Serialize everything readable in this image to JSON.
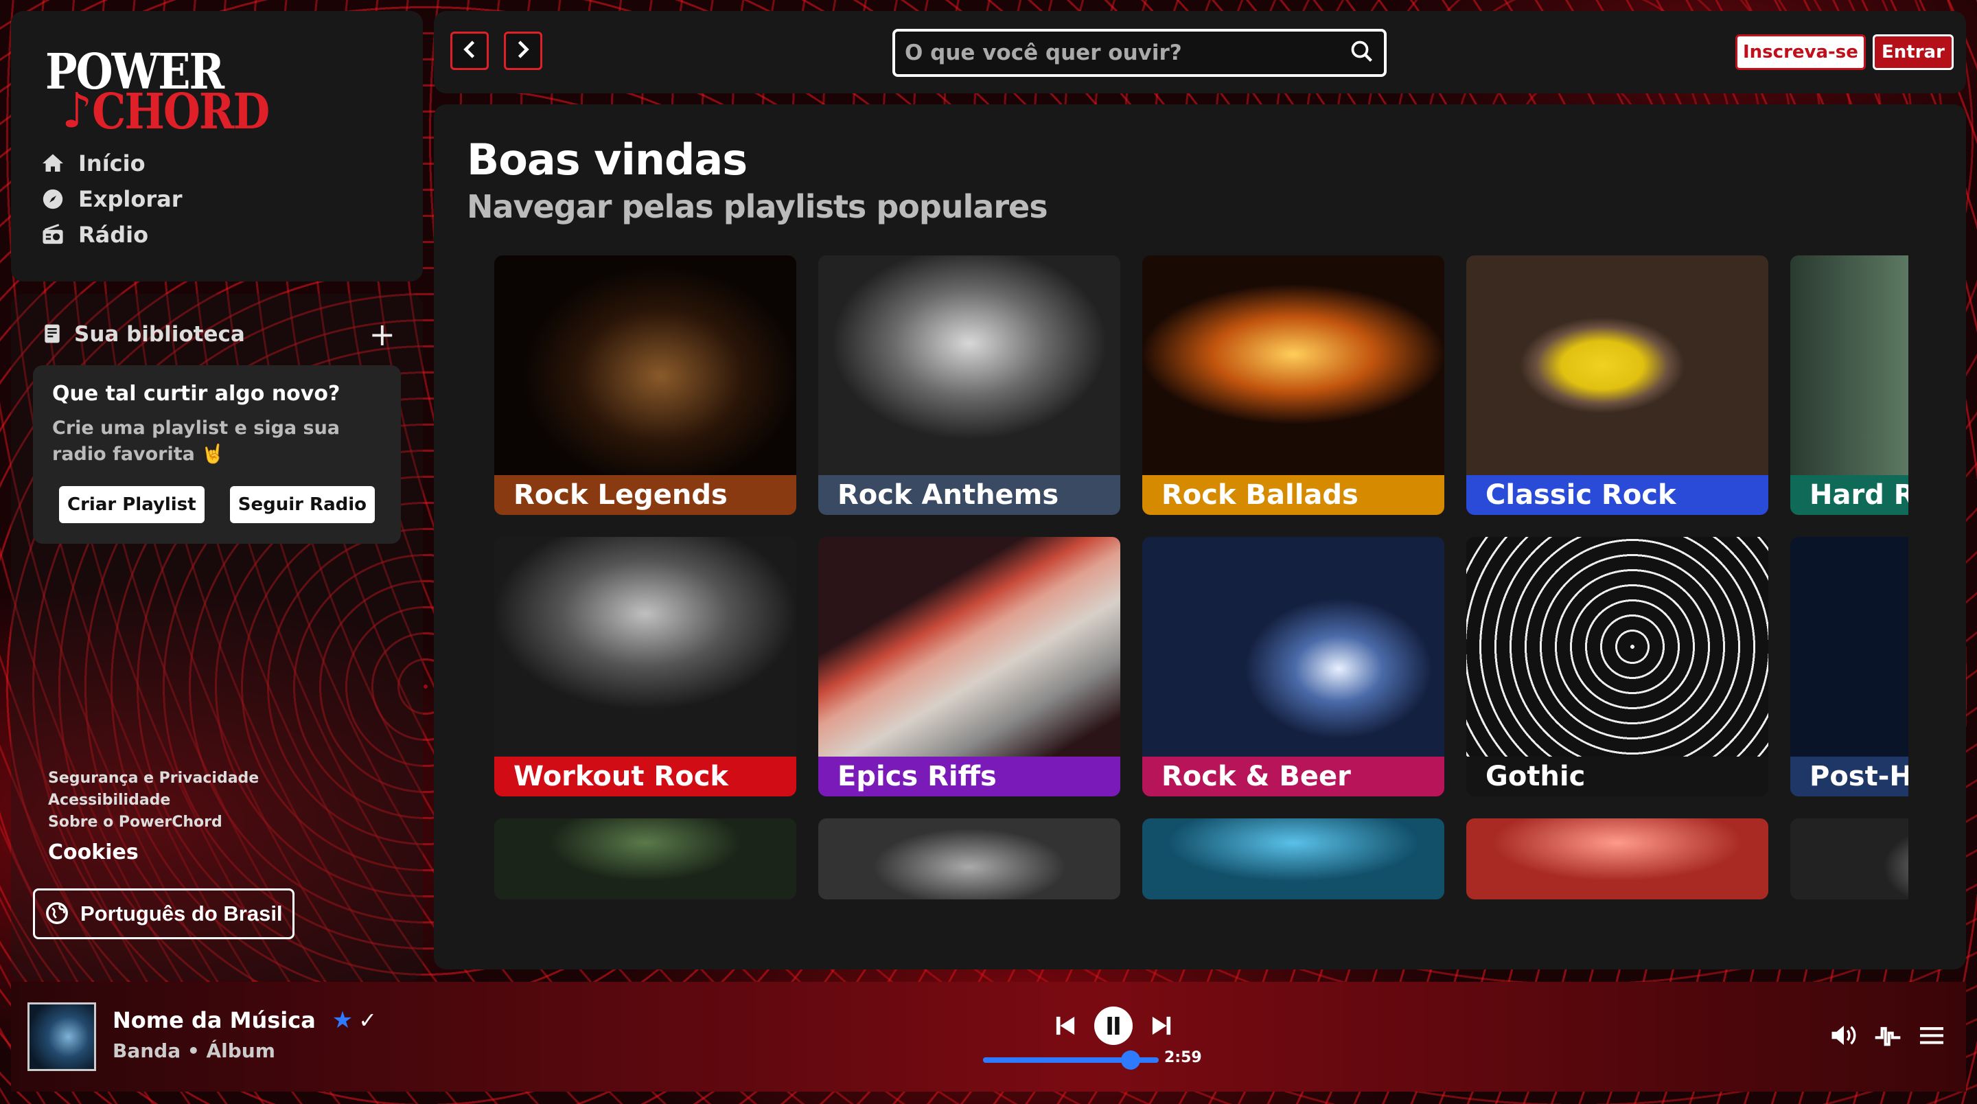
{
  "app": {
    "logo_line1": "POWER",
    "logo_line2": "CHORD"
  },
  "nav": {
    "items": [
      {
        "label": "Início",
        "icon": "home-icon"
      },
      {
        "label": "Explorar",
        "icon": "compass-icon"
      },
      {
        "label": "Rádio",
        "icon": "radio-icon"
      }
    ]
  },
  "library": {
    "title": "Sua biblioteca",
    "add_icon": "plus-icon",
    "promo": {
      "heading": "Que tal curtir algo novo?",
      "text": "Crie uma playlist e siga sua radio favorita 🤘",
      "create_button": "Criar Playlist",
      "follow_button": "Seguir Radio"
    },
    "footer_links": [
      "Segurança e Privacidade",
      "Acessibilidade",
      "Sobre o PowerChord"
    ],
    "cookies": "Cookies",
    "language_button": "Português do Brasil"
  },
  "topbar": {
    "search_placeholder": "O que você quer ouvir?",
    "signup_button": "Inscreva-se",
    "login_button": "Entrar"
  },
  "main": {
    "title": "Boas vindas",
    "subtitle": "Navegar pelas playlists populares",
    "playlists": [
      {
        "label": "Rock Legends",
        "color": "#8a3a10"
      },
      {
        "label": "Rock Anthems",
        "color": "#3a4a62"
      },
      {
        "label": "Rock Ballads",
        "color": "#d68a00"
      },
      {
        "label": "Classic Rock",
        "color": "#2a4ad8"
      },
      {
        "label": "Hard Rock",
        "color": "#0f6b58"
      },
      {
        "label": "Workout Rock",
        "color": "#d20c14"
      },
      {
        "label": "Epics Riffs",
        "color": "#7a1ab8"
      },
      {
        "label": "Rock & Beer",
        "color": "#b8145a"
      },
      {
        "label": "Gothic",
        "color": "#141414"
      },
      {
        "label": "Post-Hardcore",
        "color": "#1e3766"
      }
    ]
  },
  "player": {
    "song": "Nome da Música",
    "artist_album": "Banda • Álbum",
    "time": "2:59",
    "progress": 0.84,
    "accent": "#2f7bff"
  }
}
